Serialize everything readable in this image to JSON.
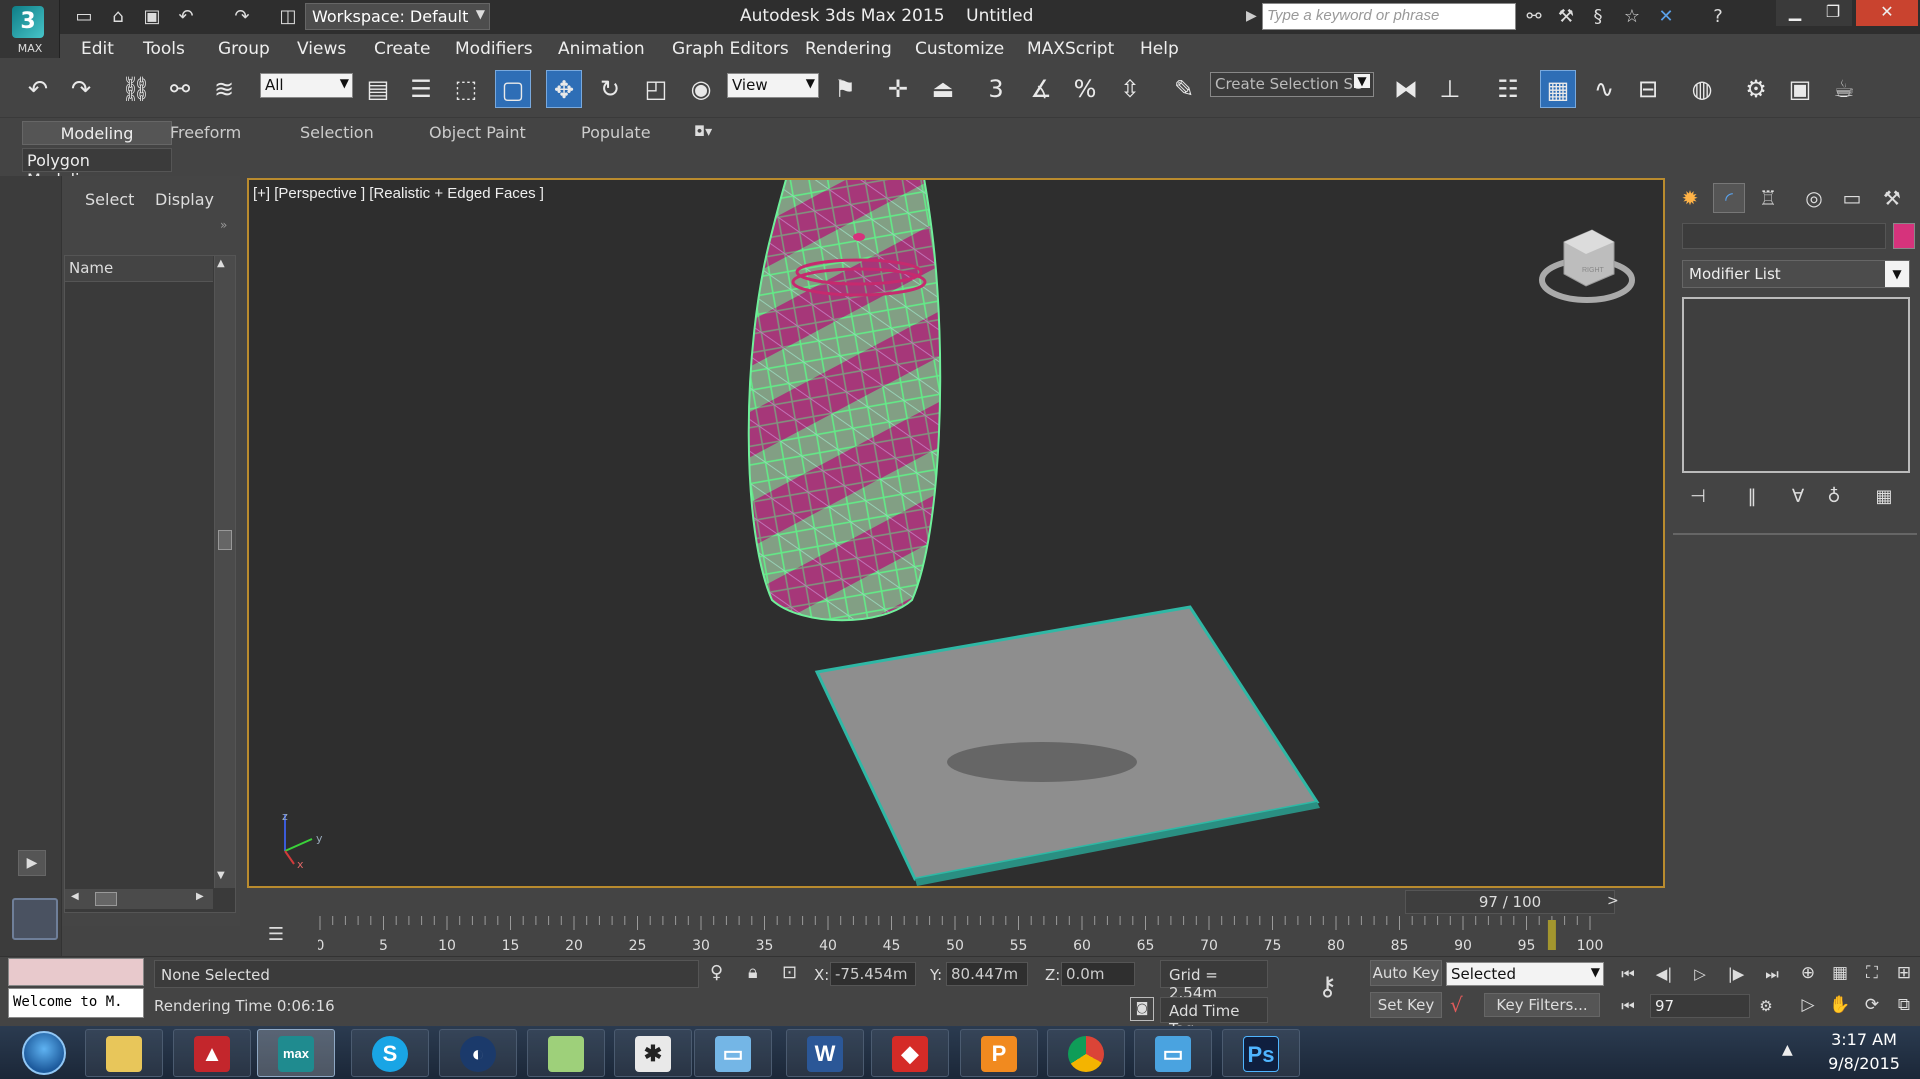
{
  "titlebar": {
    "logo_text": "MAX",
    "workspace": "Workspace: Default",
    "app_title": "Autodesk 3ds Max 2015    Untitled",
    "search_placeholder": "Type a keyword or phrase"
  },
  "menu": [
    "Edit",
    "Tools",
    "Group",
    "Views",
    "Create",
    "Modifiers",
    "Animation",
    "Graph Editors",
    "Rendering",
    "Customize",
    "MAXScript",
    "Help"
  ],
  "toolbar": {
    "filter_value": "All",
    "refcoord_value": "View",
    "snap_labels": {
      "snap": "3",
      "percent": "%"
    },
    "selection_set_placeholder": "Create Selection Se"
  },
  "ribbon": {
    "tabs": [
      "Modeling",
      "Freeform",
      "Selection",
      "Object Paint",
      "Populate"
    ],
    "panel_label": "Polygon Modeling"
  },
  "scene_explorer": {
    "tab_select": "Select",
    "tab_display": "Display",
    "column_name": "Name"
  },
  "viewport": {
    "label": "[+] [Perspective ] [Realistic + Edged Faces ]",
    "viewcube_face": "RIGHT",
    "gizmo_axes": {
      "z": "z",
      "x": "x",
      "y": "y"
    }
  },
  "command_panel": {
    "modifier_list": "Modifier List"
  },
  "timeline": {
    "frame_slider": "97 / 100",
    "current_frame": 97,
    "total_frames": 100,
    "ticks": [
      "0",
      "5",
      "10",
      "15",
      "20",
      "25",
      "30",
      "35",
      "40",
      "45",
      "50",
      "55",
      "60",
      "65",
      "70",
      "75",
      "80",
      "85",
      "90",
      "95",
      "100"
    ]
  },
  "status": {
    "welcome": "Welcome to M.",
    "selection": "None Selected",
    "render_time": "Rendering Time  0:06:16",
    "x_label": "X:",
    "x_value": "-75.454m",
    "y_label": "Y:",
    "y_value": "80.447m",
    "z_label": "Z:",
    "z_value": "0.0m",
    "grid": "Grid = 2.54m",
    "add_time_tag": "Add Time Tag",
    "auto_key": "Auto Key",
    "set_key": "Set Key",
    "key_mode": "Selected",
    "key_filters": "Key Filters...",
    "frame_field": "97"
  },
  "taskbar": {
    "apps": [
      "Windows Explorer",
      "Autodesk AutoCAD",
      "3ds Max",
      "Skype",
      "Cinema 4D",
      "Folder",
      "Mudbox",
      "Photo Viewer",
      "Microsoft Word",
      "SketchUp",
      "Presentation",
      "Google Chrome",
      "Photo Gallery",
      "Adobe Photoshop"
    ],
    "labels": {
      "word": "W",
      "skype": "S",
      "ps": "Ps",
      "presentation": "P",
      "max": "max"
    },
    "time": "3:17 AM",
    "date": "9/8/2015"
  },
  "colors": {
    "accent": "#2e6eb6",
    "viewport_border": "#b98b2e",
    "wire_green": "#5fe88a",
    "wire_magenta": "#c62a6e",
    "plane": "#8e8e8e",
    "plane_edge": "#2fb8a5"
  }
}
